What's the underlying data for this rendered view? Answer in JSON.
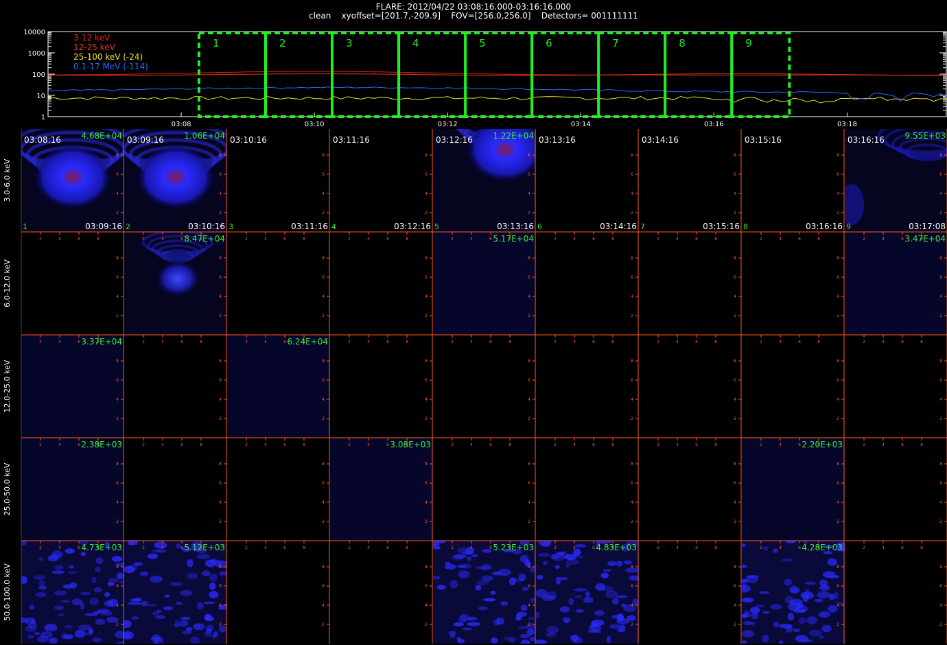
{
  "header": {
    "title_line1": "FLARE: 2012/04/22 03:08:16.000-03:16:16.000",
    "title_line2": "clean    xyoffset=[201.7,-209.9]    FOV=[256.0,256.0]    Detectors= 001111111"
  },
  "colors": {
    "background": "#000000",
    "axis": "#ff5a1e",
    "label": "#33ee33",
    "box": "#22ee22",
    "series_3_12": "#e02020",
    "series_12_25": "#e03a1a",
    "series_25_100": "#f0e02a",
    "series_0117": "#2a6aff",
    "image": "#1a2aff"
  },
  "chart_data": {
    "type": "line",
    "lightcurve": {
      "y_scale": "log",
      "ylim": [
        1,
        10000
      ],
      "y_ticks": [
        "10000",
        "1000",
        "100",
        "10",
        "1"
      ],
      "x_range_minutes": [
        "03:06:00",
        "03:19:30"
      ],
      "x_ticks": [
        "03:08",
        "03:10",
        "03:12",
        "03:14",
        "03:16",
        "03:18"
      ],
      "series": [
        {
          "name": "3-12 keV",
          "approx_level": 95,
          "peak_time": "03:10:00",
          "peak": 150
        },
        {
          "name": "12-25 keV",
          "approx_level": 110,
          "note": ""
        },
        {
          "name": "25-100 keV (-24)",
          "approx_level": 7
        },
        {
          "name": "0.1-17 MeV (-114)",
          "approx_level": 18
        }
      ],
      "intervals": [
        "1",
        "2",
        "3",
        "4",
        "5",
        "6",
        "7",
        "8",
        "9"
      ]
    },
    "grid": {
      "energy_bands": [
        "3.0-6.0 keV",
        "6.0-12.0 keV",
        "12.0-25.0 keV",
        "25.0-50.0 keV",
        "50.0-100.0 keV"
      ],
      "start_times": [
        "03:08:16",
        "03:09:16",
        "03:10:16",
        "03:11:16",
        "03:12:16",
        "03:13:16",
        "03:14:16",
        "03:15:16",
        "03:16:16"
      ],
      "end_times": [
        "03:09:16",
        "03:10:16",
        "03:11:16",
        "03:12:16",
        "03:13:16",
        "03:14:16",
        "03:15:16",
        "03:16:16",
        "03:17:08"
      ],
      "interval_numbers": [
        "1",
        "2",
        "3",
        "4",
        "5",
        "6",
        "7",
        "8",
        "9"
      ],
      "frame_ticks": [
        "2",
        "4",
        "6",
        "8"
      ],
      "max_values": [
        [
          "4.68E+04",
          "1.06E+04",
          "",
          "",
          "1.22E+04",
          "",
          "",
          "",
          "9.55E+03"
        ],
        [
          "",
          "8.47E+04",
          "",
          "",
          "5.17E+04",
          "",
          "",
          "",
          "3.47E+04"
        ],
        [
          "3.37E+04",
          "",
          "6.24E+04",
          "",
          "",
          "",
          "",
          "",
          ""
        ],
        [
          "2.38E+03",
          "",
          "",
          "3.08E+03",
          "",
          "",
          "",
          "2.20E+03",
          ""
        ],
        [
          "4.73E+03",
          "5.12E+03",
          "",
          "",
          "5.23E+03",
          "4.83E+03",
          "",
          "4.28E+03",
          ""
        ]
      ],
      "image_kind": [
        [
          "bright",
          "bright",
          "none",
          "none",
          "bright",
          "none",
          "none",
          "none",
          "faint"
        ],
        [
          "none",
          "source",
          "none",
          "none",
          "dim",
          "none",
          "none",
          "none",
          "dim"
        ],
        [
          "dim",
          "none",
          "dim",
          "none",
          "none",
          "none",
          "none",
          "none",
          "none"
        ],
        [
          "dim",
          "none",
          "none",
          "dim",
          "none",
          "none",
          "none",
          "dim",
          "none"
        ],
        [
          "noise",
          "noise",
          "none",
          "none",
          "noise",
          "noise",
          "none",
          "noise",
          "none"
        ]
      ]
    }
  }
}
